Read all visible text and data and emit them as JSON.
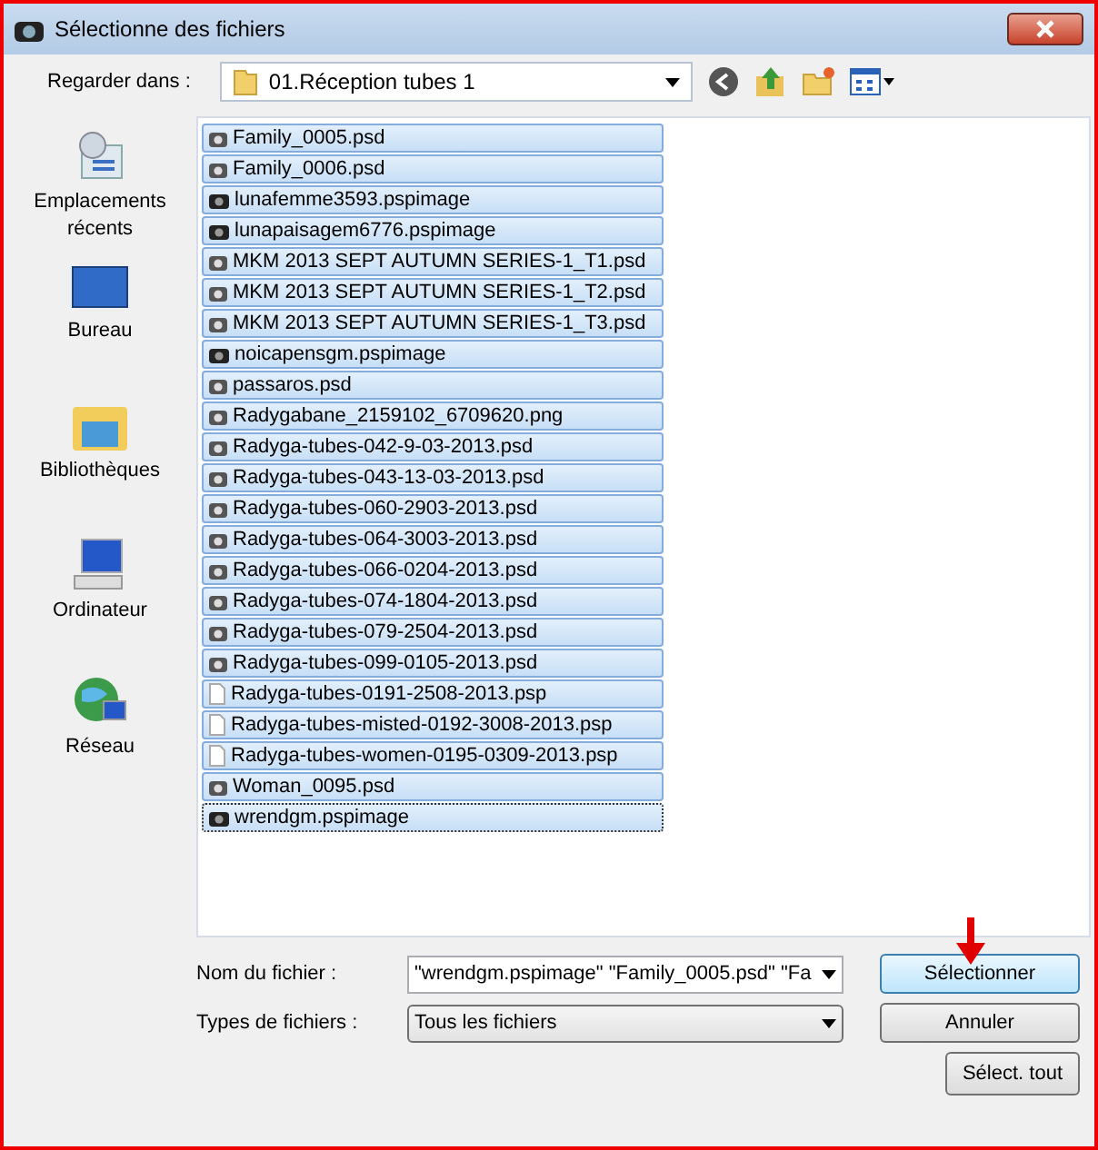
{
  "window": {
    "title": "Sélectionne des fichiers"
  },
  "toolbar": {
    "label": "Regarder dans :",
    "location": "01.Réception tubes 1"
  },
  "places": [
    {
      "kind": "recent",
      "label": "Emplacements récents"
    },
    {
      "kind": "desktop",
      "label": "Bureau"
    },
    {
      "kind": "libraries",
      "label": "Bibliothèques"
    },
    {
      "kind": "computer",
      "label": "Ordinateur"
    },
    {
      "kind": "network",
      "label": "Réseau"
    }
  ],
  "files": [
    {
      "name": "Family_0005.psd",
      "kind": "photo",
      "selected": true,
      "focused": false
    },
    {
      "name": "Family_0006.psd",
      "kind": "photo",
      "selected": true,
      "focused": false
    },
    {
      "name": "lunafemme3593.pspimage",
      "kind": "camera",
      "selected": true,
      "focused": false
    },
    {
      "name": "lunapaisagem6776.pspimage",
      "kind": "camera",
      "selected": true,
      "focused": false
    },
    {
      "name": "MKM 2013 SEPT AUTUMN SERIES-1_T1.psd",
      "kind": "photo",
      "selected": true,
      "focused": false
    },
    {
      "name": "MKM 2013 SEPT AUTUMN SERIES-1_T2.psd",
      "kind": "photo",
      "selected": true,
      "focused": false
    },
    {
      "name": "MKM 2013 SEPT AUTUMN SERIES-1_T3.psd",
      "kind": "photo",
      "selected": true,
      "focused": false
    },
    {
      "name": "noicapensgm.pspimage",
      "kind": "camera",
      "selected": true,
      "focused": false
    },
    {
      "name": "passaros.psd",
      "kind": "photo",
      "selected": true,
      "focused": false
    },
    {
      "name": "Radygabane_2159102_6709620.png",
      "kind": "photo",
      "selected": true,
      "focused": false
    },
    {
      "name": "Radyga-tubes-042-9-03-2013.psd",
      "kind": "photo",
      "selected": true,
      "focused": false
    },
    {
      "name": "Radyga-tubes-043-13-03-2013.psd",
      "kind": "photo",
      "selected": true,
      "focused": false
    },
    {
      "name": "Radyga-tubes-060-2903-2013.psd",
      "kind": "photo",
      "selected": true,
      "focused": false
    },
    {
      "name": "Radyga-tubes-064-3003-2013.psd",
      "kind": "photo",
      "selected": true,
      "focused": false
    },
    {
      "name": "Radyga-tubes-066-0204-2013.psd",
      "kind": "photo",
      "selected": true,
      "focused": false
    },
    {
      "name": "Radyga-tubes-074-1804-2013.psd",
      "kind": "photo",
      "selected": true,
      "focused": false
    },
    {
      "name": "Radyga-tubes-079-2504-2013.psd",
      "kind": "photo",
      "selected": true,
      "focused": false
    },
    {
      "name": "Radyga-tubes-099-0105-2013.psd",
      "kind": "photo",
      "selected": true,
      "focused": false
    },
    {
      "name": "Radyga-tubes-0191-2508-2013.psp",
      "kind": "blank",
      "selected": true,
      "focused": false
    },
    {
      "name": "Radyga-tubes-misted-0192-3008-2013.psp",
      "kind": "blank",
      "selected": true,
      "focused": false
    },
    {
      "name": "Radyga-tubes-women-0195-0309-2013.psp",
      "kind": "blank",
      "selected": true,
      "focused": false
    },
    {
      "name": "Woman_0095.psd",
      "kind": "photo",
      "selected": true,
      "focused": false
    },
    {
      "name": "wrendgm.pspimage",
      "kind": "camera",
      "selected": true,
      "focused": true
    }
  ],
  "filename": {
    "label": "Nom du fichier :",
    "value": "\"wrendgm.pspimage\" \"Family_0005.psd\" \"Fa"
  },
  "filetype": {
    "label": "Types de fichiers :",
    "value": "Tous les fichiers"
  },
  "buttons": [
    {
      "label": "Sélectionner",
      "default": true
    },
    {
      "label": "Annuler",
      "default": false
    },
    {
      "label": "Sélect. tout",
      "default": false
    }
  ]
}
